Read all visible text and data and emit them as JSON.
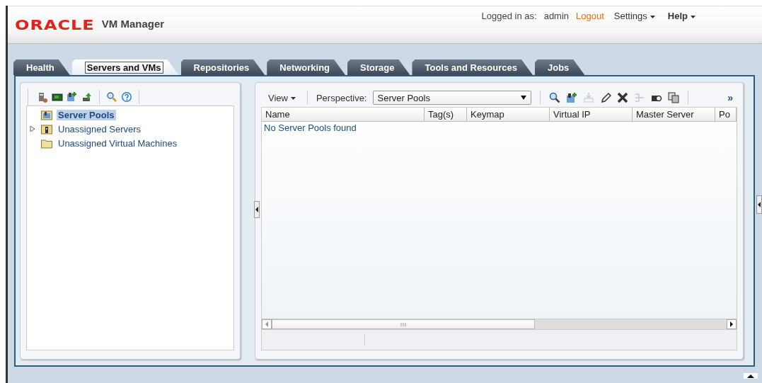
{
  "header": {
    "logo": "ORACLE",
    "app_name": "VM Manager",
    "logged_in_label": "Logged in as:",
    "user": "admin",
    "logout": "Logout",
    "menus": [
      "Settings",
      "Help"
    ]
  },
  "tabs": [
    {
      "label": "Health",
      "selected": false
    },
    {
      "label": "Servers and VMs",
      "selected": true
    },
    {
      "label": "Repositories",
      "selected": false
    },
    {
      "label": "Networking",
      "selected": false
    },
    {
      "label": "Storage",
      "selected": false
    },
    {
      "label": "Tools and Resources",
      "selected": false
    },
    {
      "label": "Jobs",
      "selected": false
    }
  ],
  "navigator": {
    "tree": [
      {
        "label": "Server Pools",
        "selected": true,
        "expander": false,
        "kind": "pool"
      },
      {
        "label": "Unassigned Servers",
        "selected": false,
        "expander": true,
        "kind": "server"
      },
      {
        "label": "Unassigned Virtual Machines",
        "selected": false,
        "expander": false,
        "kind": "folder"
      }
    ]
  },
  "management": {
    "view_menu": "View",
    "perspective_label": "Perspective:",
    "perspective": "Server Pools",
    "more": "»",
    "toolbar": [
      {
        "disabled": false
      },
      {
        "disabled": false
      },
      {
        "disabled": true
      },
      {
        "disabled": false
      },
      {
        "disabled": false
      },
      {
        "disabled": true
      },
      {
        "disabled": false
      },
      {
        "disabled": false
      }
    ],
    "table": {
      "columns": [
        "Name",
        "Tag(s)",
        "Keymap",
        "Virtual IP",
        "Master Server",
        "Po"
      ],
      "empty_message": "No Server Pools found"
    }
  }
}
